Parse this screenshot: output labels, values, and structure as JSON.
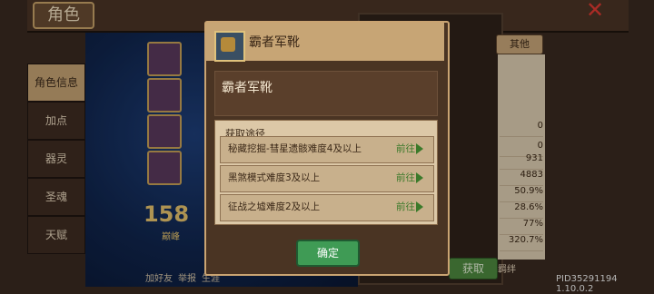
{
  "top": {
    "title": "角色",
    "close_icon": "close-icon"
  },
  "left_menu": [
    {
      "label": "角色信息",
      "active": true
    },
    {
      "label": "加点",
      "active": false
    },
    {
      "label": "器灵",
      "active": false
    },
    {
      "label": "圣魂",
      "active": false
    },
    {
      "label": "天赋",
      "active": false
    }
  ],
  "scene": {
    "level": "158",
    "level_sub": "巅峰",
    "bottom_links": [
      "加好友",
      "举报",
      "生涯"
    ]
  },
  "right_panel": {
    "other_button": "其他",
    "stats": [
      "0",
      "0",
      "931",
      "4883",
      "50.9%",
      "28.6%",
      "77%",
      "320.7%"
    ],
    "get_button": "获取",
    "fetter_label": "羁绊"
  },
  "pid_label": "PID35291194 1.10.0.2",
  "dialog": {
    "title": "霸者军靴",
    "item_name": "霸者军靴",
    "source_header": "获取途径",
    "sources": [
      {
        "text": "秘藏挖掘-彗星遗骸难度4及以上",
        "action": "前往"
      },
      {
        "text": "黑煞模式难度3及以上",
        "action": "前往"
      },
      {
        "text": "征战之墟难度2及以上",
        "action": "前往"
      }
    ],
    "confirm": "确定"
  },
  "colors": {
    "panel_brown": "#4a3423",
    "header_tan": "#c7a575",
    "confirm_green": "#3f9b55",
    "goto_green": "#3b7a2a",
    "close_red": "#e23a32"
  }
}
